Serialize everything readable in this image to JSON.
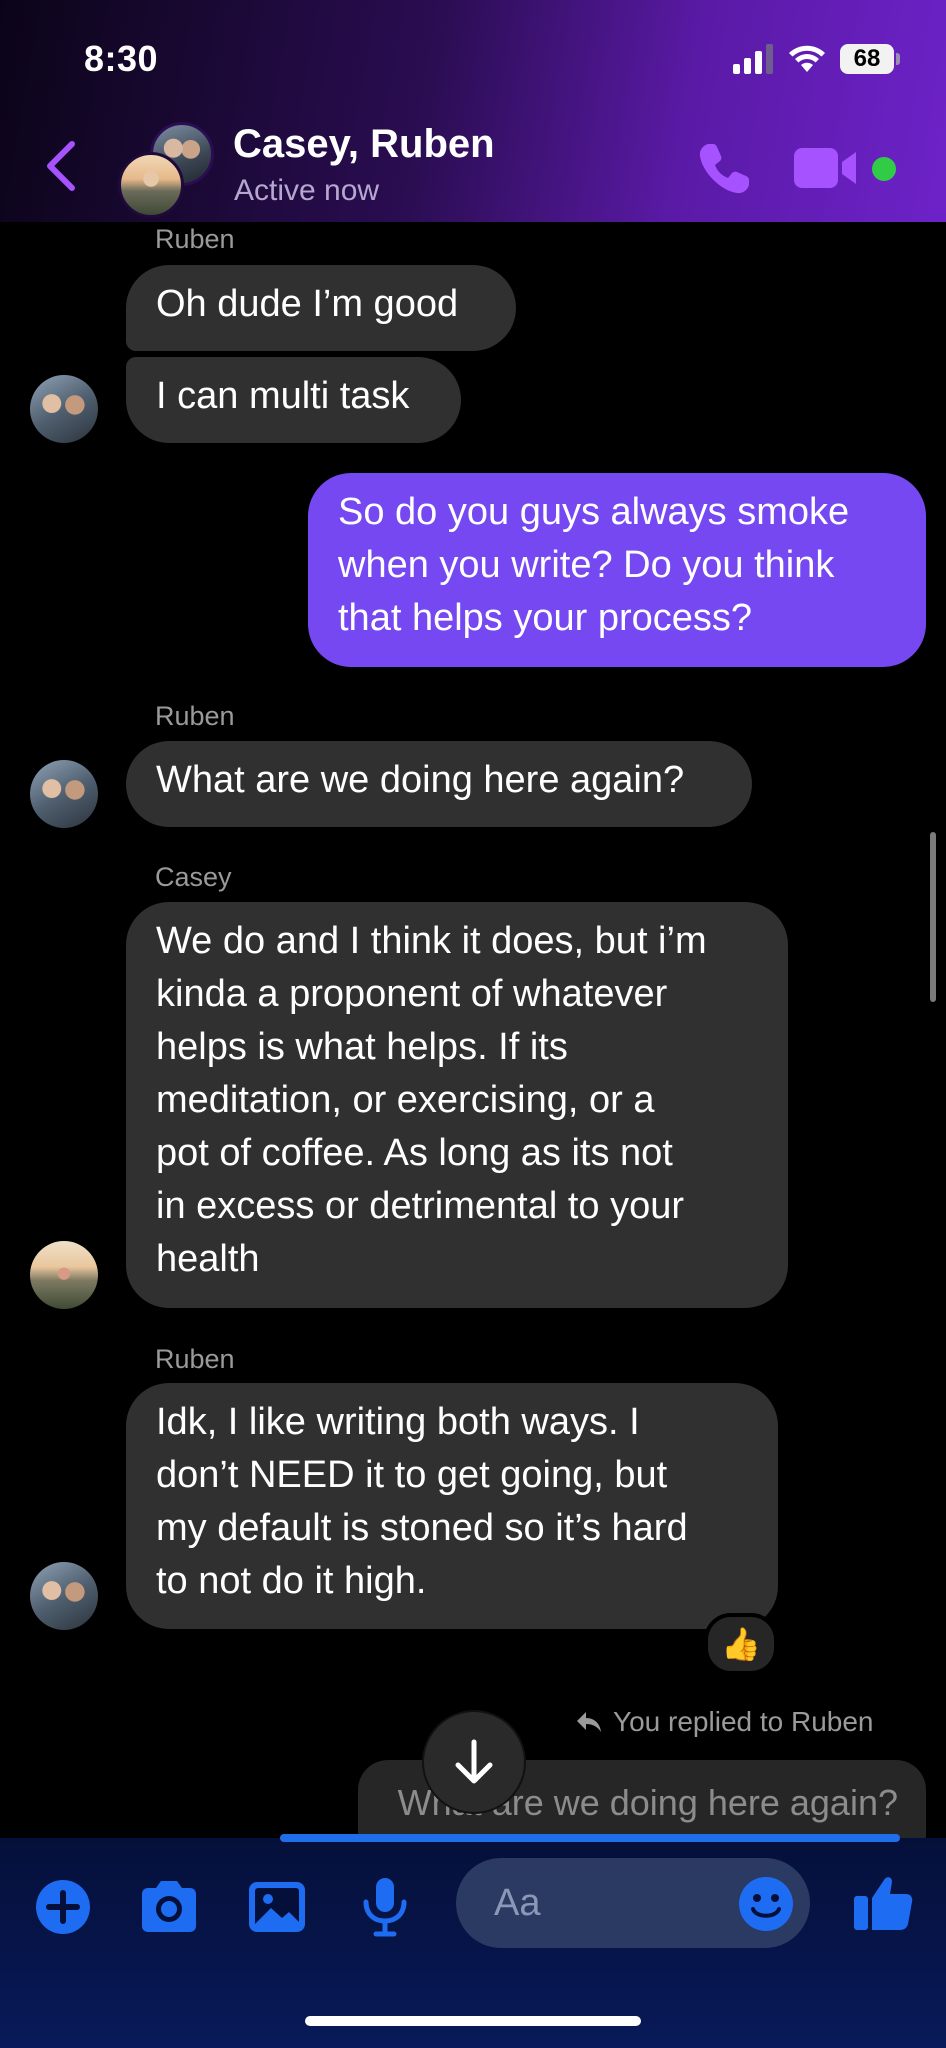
{
  "status_bar": {
    "time": "8:30",
    "battery": "68"
  },
  "header": {
    "title": "Casey, Ruben",
    "subtitle": "Active now"
  },
  "messages": [
    {
      "sender": "Ruben",
      "text": "Oh dude I’m good"
    },
    {
      "text": "I can multi task"
    },
    {
      "text": "So do you guys always smoke\nwhen you write? Do you think\nthat helps your process?"
    },
    {
      "sender": "Ruben",
      "text": "What are we doing here again?"
    },
    {
      "sender": "Casey",
      "text": "We do and I think it does, but i’m\nkinda a proponent of whatever\nhelps is what helps. If its\nmeditation, or exercising, or a\npot of coffee. As long as its not\nin excess or detrimental to your\nhealth"
    },
    {
      "sender": "Ruben",
      "text": "Idk, I like writing both ways. I\ndon’t NEED it to get going, but\nmy default is stoned so it’s hard\nto not do it high.",
      "reaction": "👍"
    }
  ],
  "reply": {
    "label": "You replied to Ruben",
    "quoted": "What are we doing here again?"
  },
  "composer": {
    "placeholder": "Aa"
  },
  "colors": {
    "outgoing_bubble": "#7648f2",
    "incoming_bubble": "#303030",
    "accent": "#a652ff",
    "composer_blue": "#1e6cf2"
  },
  "icons": [
    "back-chevron",
    "phone",
    "video-camera",
    "plus",
    "camera",
    "image",
    "microphone",
    "emoji",
    "thumbs-up",
    "arrow-down"
  ]
}
